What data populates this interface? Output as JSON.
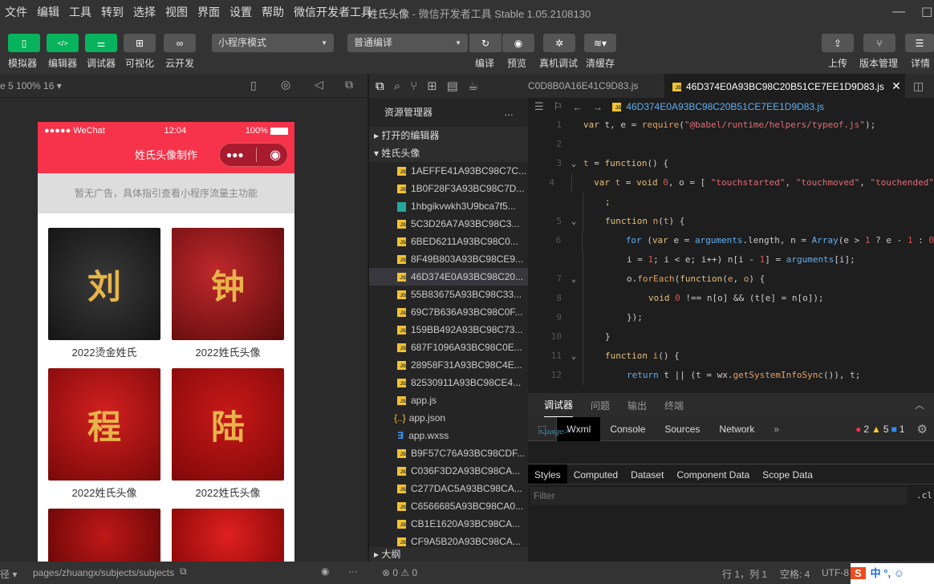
{
  "menu": [
    "文件",
    "编辑",
    "工具",
    "转到",
    "选择",
    "视图",
    "界面",
    "设置",
    "帮助",
    "微信开发者工具"
  ],
  "window": {
    "title": "姓氏头像",
    "subtitle": "- 微信开发者工具 Stable 1.05.2108130"
  },
  "toolbar": {
    "simulator": "模拟器",
    "editor": "编辑器",
    "debugger": "调试器",
    "visual": "可视化",
    "cloud": "云开发",
    "mode": "小程序模式",
    "compile_mode": "普通编译",
    "compile": "编译",
    "preview": "预览",
    "remote_debug": "真机调试",
    "clear_cache": "清缓存",
    "upload": "上传",
    "version": "版本管理",
    "details": "详情",
    "accent": "#07b35c"
  },
  "simbar": {
    "device": "e 5 100% 16 ▾"
  },
  "phone": {
    "carrier": "●●●●● WeChat",
    "time": "12:04",
    "battery": "100%",
    "nav_title": "姓氏头像制作",
    "ad": "暂无广告，具体指引查看小程序流量主功能",
    "brand_color": "#f6334a",
    "cards": [
      {
        "caption": "2022烫金姓氏",
        "glyph": "刘"
      },
      {
        "caption": "2022姓氏头像",
        "glyph": "钟"
      },
      {
        "caption": "2022姓氏头像",
        "glyph": "程"
      },
      {
        "caption": "2022姓氏头像",
        "glyph": "陆"
      },
      {
        "caption": "",
        "glyph": ""
      },
      {
        "caption": "",
        "glyph": ""
      }
    ]
  },
  "tabs": {
    "prev": "C0D8B0A16E41C9D83.js",
    "active": "46D374E0A93BC98C20B51CE7EE1D9D83.js"
  },
  "explorer": {
    "title": "资源管理器",
    "more": "…",
    "open_editors": "打开的编辑器",
    "project": "姓氏头像",
    "outline": "大纲",
    "files": [
      {
        "name": "1AEFFE41A93BC98C7C...",
        "type": "js"
      },
      {
        "name": "1B0F28F3A93BC98C7D...",
        "type": "js"
      },
      {
        "name": "1hbgikvwkh3U9bca7f5...",
        "type": "img"
      },
      {
        "name": "5C3D26A7A93BC98C3...",
        "type": "js"
      },
      {
        "name": "6BED6211A93BC98C0...",
        "type": "js"
      },
      {
        "name": "8F49B803A93BC98CE9...",
        "type": "js"
      },
      {
        "name": "46D374E0A93BC98C20...",
        "type": "js",
        "selected": true
      },
      {
        "name": "55B83675A93BC98C33...",
        "type": "js"
      },
      {
        "name": "69C7B636A93BC98C0F...",
        "type": "js"
      },
      {
        "name": "159BB492A93BC98C73...",
        "type": "js"
      },
      {
        "name": "687F1096A93BC98C0E...",
        "type": "js"
      },
      {
        "name": "28958F31A93BC98C4E...",
        "type": "js"
      },
      {
        "name": "82530911A93BC98CE4...",
        "type": "js"
      },
      {
        "name": "app.js",
        "type": "js"
      },
      {
        "name": "app.json",
        "type": "json"
      },
      {
        "name": "app.wxss",
        "type": "css"
      },
      {
        "name": "B9F57C76A93BC98CDF...",
        "type": "js"
      },
      {
        "name": "C036F3D2A93BC98CA...",
        "type": "js"
      },
      {
        "name": "C277DAC5A93BC98CA...",
        "type": "js"
      },
      {
        "name": "C6566685A93BC98CA0...",
        "type": "js"
      },
      {
        "name": "CB1E1620A93BC98CA...",
        "type": "js"
      },
      {
        "name": "CF9A5B20A93BC98CA...",
        "type": "js"
      }
    ]
  },
  "breadcrumb": "46D374E0A93BC98C20B51CE7EE1D9D83.js",
  "code": [
    {
      "no": "1",
      "fold": false,
      "indent": 0,
      "t": [
        [
          "k",
          "var "
        ],
        [
          "p",
          "t, e = "
        ],
        [
          "m",
          "require"
        ],
        [
          "p",
          "("
        ],
        [
          "s",
          "\"@babel/runtime/helpers/typeof.js\""
        ],
        [
          "p",
          ");"
        ]
      ]
    },
    {
      "no": "2",
      "fold": false,
      "indent": 0,
      "t": []
    },
    {
      "no": "3",
      "fold": true,
      "indent": 0,
      "t": [
        [
          "v",
          "t"
        ],
        [
          "p",
          " = "
        ],
        [
          "k",
          "function"
        ],
        [
          "p",
          "() {"
        ]
      ]
    },
    {
      "no": "4",
      "fold": false,
      "indent": 1,
      "t": [
        [
          "k",
          "var "
        ],
        [
          "v",
          "t"
        ],
        [
          "p",
          " = "
        ],
        [
          "k",
          "void "
        ],
        [
          "n",
          "0"
        ],
        [
          "p",
          ", o = [ "
        ],
        [
          "s",
          "\"touchstarted\""
        ],
        [
          "p",
          ", "
        ],
        [
          "s",
          "\"touchmoved\""
        ],
        [
          "p",
          ", "
        ],
        [
          "s",
          "\"touchended\""
        ]
      ]
    },
    {
      "no": "",
      "fold": false,
      "indent": 1,
      "t": [
        [
          "k",
          ";"
        ]
      ]
    },
    {
      "no": "5",
      "fold": true,
      "indent": 1,
      "t": [
        [
          "k",
          "function "
        ],
        [
          "v",
          "n"
        ],
        [
          "p",
          "("
        ],
        [
          "v",
          "t"
        ],
        [
          "p",
          ") {"
        ]
      ]
    },
    {
      "no": "6",
      "fold": false,
      "indent": 2,
      "t": [
        [
          "f",
          "for "
        ],
        [
          "p",
          "("
        ],
        [
          "k",
          "var "
        ],
        [
          "p",
          "e = "
        ],
        [
          "f",
          "arguments"
        ],
        [
          "p",
          ".length, n = "
        ],
        [
          "f",
          "Array"
        ],
        [
          "p",
          "(e > "
        ],
        [
          "n",
          "1"
        ],
        [
          "p",
          " ? e - "
        ],
        [
          "n",
          "1"
        ],
        [
          "p",
          " : "
        ],
        [
          "n",
          "0"
        ]
      ]
    },
    {
      "no": "",
      "fold": false,
      "indent": 2,
      "t": [
        [
          "p",
          "i = "
        ],
        [
          "n",
          "1"
        ],
        [
          "p",
          "; i < e; i++) n[i - "
        ],
        [
          "n",
          "1"
        ],
        [
          "p",
          "] = "
        ],
        [
          "f",
          "arguments"
        ],
        [
          "p",
          "[i];"
        ]
      ]
    },
    {
      "no": "7",
      "fold": true,
      "indent": 2,
      "t": [
        [
          "p",
          "o."
        ],
        [
          "m",
          "forEach"
        ],
        [
          "p",
          "("
        ],
        [
          "k",
          "function"
        ],
        [
          "p",
          "("
        ],
        [
          "v",
          "e"
        ],
        [
          "p",
          ", "
        ],
        [
          "v",
          "o"
        ],
        [
          "p",
          ") {"
        ]
      ]
    },
    {
      "no": "8",
      "fold": false,
      "indent": 3,
      "t": [
        [
          "k",
          "void "
        ],
        [
          "n",
          "0"
        ],
        [
          "p",
          " !== n[o] && (t[e] = n[o]);"
        ]
      ]
    },
    {
      "no": "9",
      "fold": false,
      "indent": 2,
      "t": [
        [
          "p",
          "});"
        ]
      ]
    },
    {
      "no": "10",
      "fold": false,
      "indent": 1,
      "t": [
        [
          "p",
          "}"
        ]
      ]
    },
    {
      "no": "11",
      "fold": true,
      "indent": 1,
      "t": [
        [
          "k",
          "function "
        ],
        [
          "v",
          "i"
        ],
        [
          "p",
          "() {"
        ]
      ]
    },
    {
      "no": "12",
      "fold": false,
      "indent": 2,
      "t": [
        [
          "f",
          "return "
        ],
        [
          "p",
          "t || (t = wx."
        ],
        [
          "m",
          "getSystemInfoSync"
        ],
        [
          "p",
          "()), t;"
        ]
      ]
    }
  ],
  "debugger": {
    "tabs": [
      "调试器",
      "问题",
      "输出",
      "终端"
    ],
    "devtabs": [
      "Wxml",
      "Console",
      "Sources",
      "Network"
    ],
    "errors": "2",
    "warnings": "5",
    "infos": "1",
    "wxml_snippet": "<page>",
    "styletabs": [
      "Styles",
      "Computed",
      "Dataset",
      "Component Data",
      "Scope Data"
    ],
    "filter_placeholder": "Filter",
    "cls": ".cl"
  },
  "statusbar": {
    "path_label": "径 ▾",
    "path": "pages/zhuangx/subjects/subjects",
    "errors": "0",
    "warnings": "0",
    "position": "行 1，列 1",
    "spaces": "空格: 4",
    "encoding": "UTF-8",
    "ime": "中 °, ☺"
  }
}
